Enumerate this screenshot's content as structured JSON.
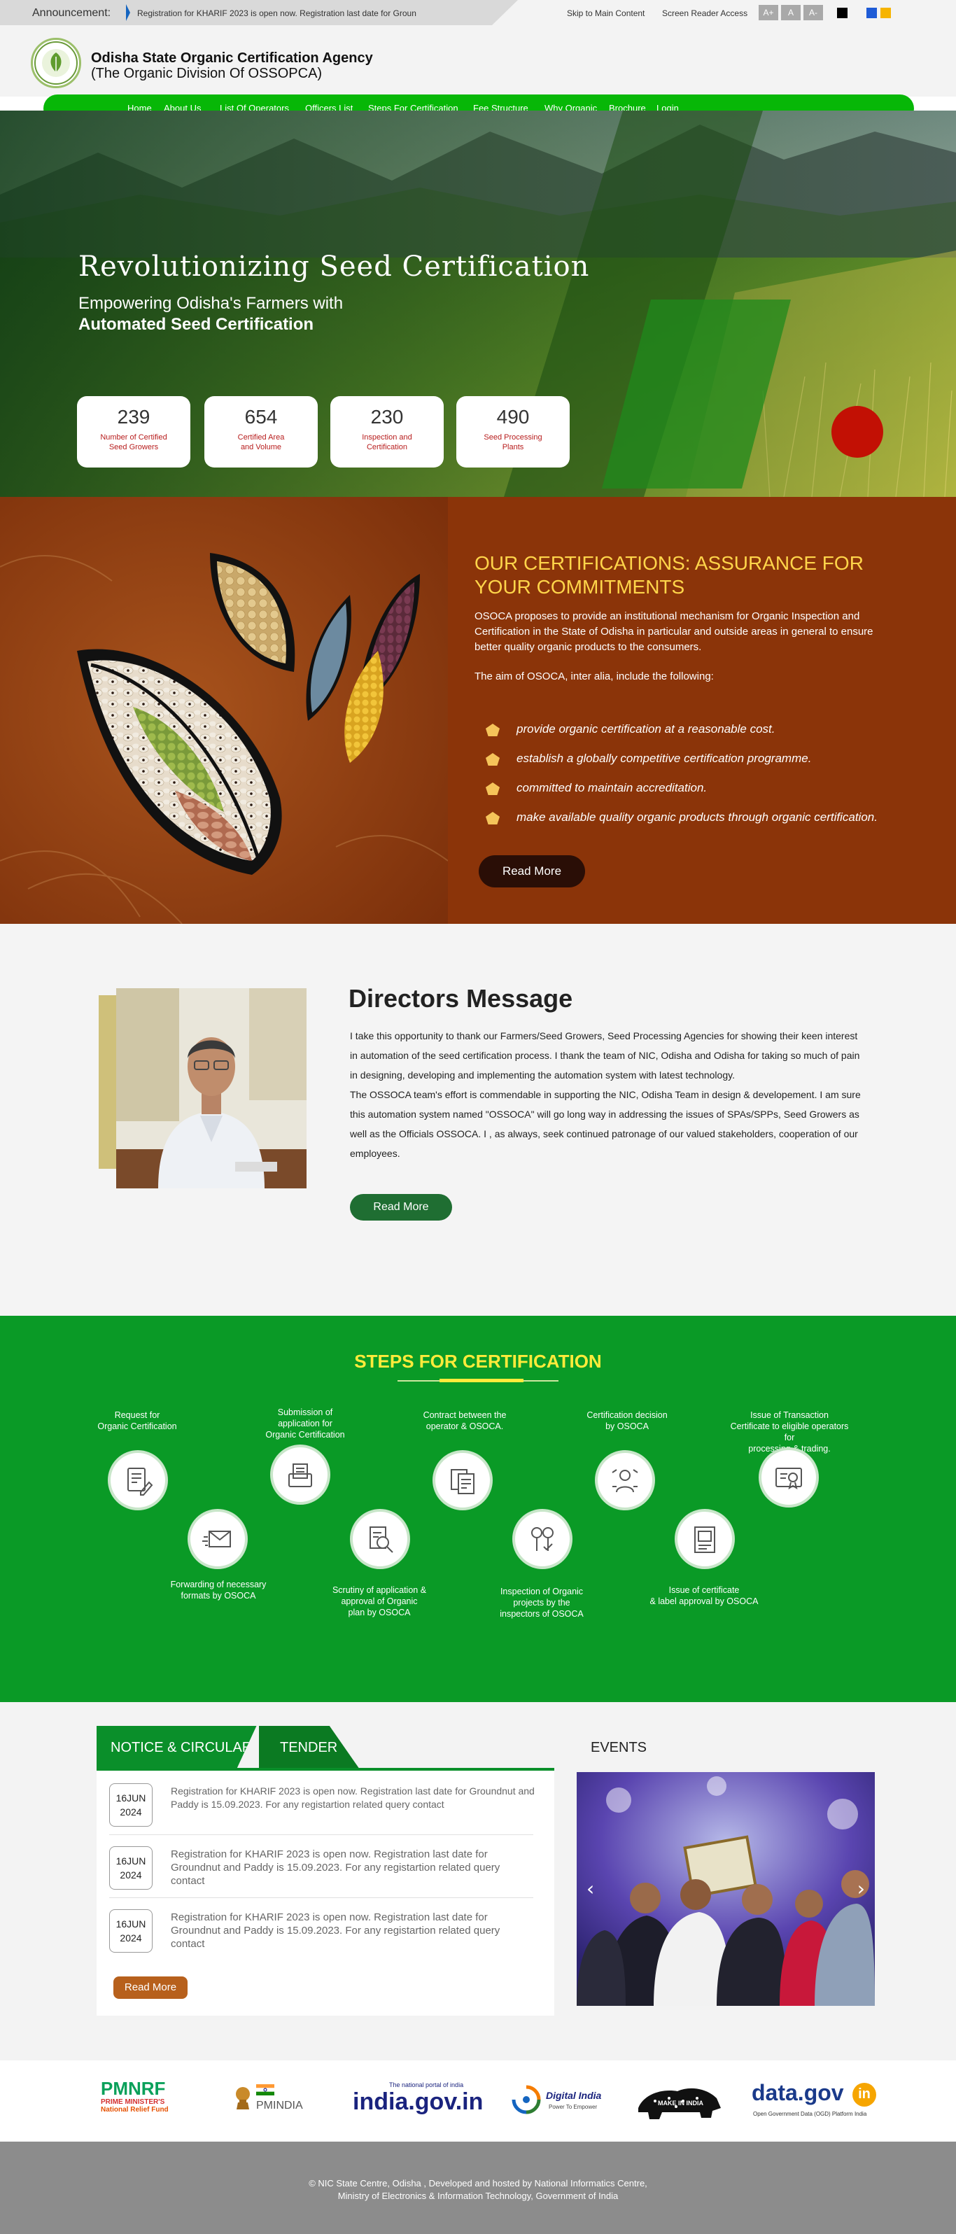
{
  "topbar": {
    "announcement_label": "Announcement:",
    "announcement_text": "Registration for KHARIF 2023 is open now. Registration last date for Groun",
    "skip_link": "Skip to Main Content",
    "screen_reader": "Screen Reader Access",
    "font_increase": "A+",
    "font_normal": "A",
    "font_decrease": "A-",
    "theme_colors": [
      "#000000",
      "#1e5bd6",
      "#f6b400"
    ]
  },
  "header": {
    "title": "Odisha State Organic Certification Agency",
    "subtitle": "(The Organic Division Of OSSOPCA)"
  },
  "nav": [
    "Home",
    "About Us",
    "List Of Operators",
    "Officers List",
    "Steps For Certification",
    "Fee Structure",
    "Why Organic",
    "Brochure",
    "Login"
  ],
  "hero": {
    "title": "Revolutionizing Seed Certification",
    "subtitle_line1": "Empowering Odisha's Farmers with",
    "subtitle_line2": "Automated Seed Certification",
    "stats": [
      {
        "value": "239",
        "label_line1": "Number of Certified",
        "label_line2": "Seed Growers"
      },
      {
        "value": "654",
        "label_line1": "Certified Area",
        "label_line2": "and Volume"
      },
      {
        "value": "230",
        "label_line1": "Inspection and",
        "label_line2": "Certification"
      },
      {
        "value": "490",
        "label_line1": "Seed Processing",
        "label_line2": "Plants"
      }
    ]
  },
  "certifications": {
    "title_line1": "OUR CERTIFICATIONS: ASSURANCE FOR",
    "title_line2": "YOUR COMMITMENTS",
    "paragraph": "OSOCA proposes to provide an institutional mechanism for Organic Inspection and Certification in the State of Odisha in particular and outside areas in general to ensure better quality organic products to the consumers.",
    "aim": "The aim of OSOCA, inter alia, include the following:",
    "items": [
      "provide organic certification at a reasonable cost.",
      "establish a globally competitive certification programme.",
      "committed to maintain accreditation.",
      "make available quality organic products through organic certification."
    ],
    "button": "Read More"
  },
  "directors": {
    "title": "Directors Message",
    "para1": "I take this opportunity to thank our Farmers/Seed Growers, Seed Processing Agencies for showing their keen interest in automation of the seed certification process. I thank the team of NIC, Odisha and Odisha for taking so much of pain in designing, developing and implementing the automation system with latest technology.",
    "para2": "The OSSOCA team's effort is commendable in supporting the NIC, Odisha Team in design & developement. I am sure this automation system named \"OSSOCA\" will go long way in addressing the issues of SPAs/SPPs, Seed Growers as well as the Officials OSSOCA. I , as always, seek continued patronage of our valued stakeholders, cooperation of our employees.",
    "button": "Read More"
  },
  "steps": {
    "title": "STEPS FOR CERTIFICATION",
    "items": [
      {
        "text": "Request for\nOrganic Certification",
        "icon": "form-icon"
      },
      {
        "text": "Forwarding of necessary\nformats by OSOCA",
        "icon": "envelope-icon"
      },
      {
        "text": "Submission of\napplication for\nOrganic Certification",
        "icon": "application-icon"
      },
      {
        "text": "Scrutiny of application &\napproval of Organic\nplan by OSOCA",
        "icon": "scrutiny-icon"
      },
      {
        "text": "Contract between the\noperator & OSOCA.",
        "icon": "contract-icon"
      },
      {
        "text": "Inspection of Organic\nprojects by the\ninspectors of OSOCA",
        "icon": "inspection-icon"
      },
      {
        "text": "Certification decision\nby OSOCA",
        "icon": "decision-icon"
      },
      {
        "text": "Issue of certificate\n& label approval by OSOCA",
        "icon": "certificate-label-icon"
      },
      {
        "text": "Issue of Transaction\nCertificate to eligible operators for\nprocessing & trading.",
        "icon": "transaction-certificate-icon"
      }
    ]
  },
  "notices": {
    "tab_notice": "NOTICE & CIRCULARS",
    "tab_tender": "TENDER",
    "items": [
      {
        "day": "16JUN",
        "year": "2024",
        "text": "Registration for KHARIF 2023 is open now. Registration last date for Groundnut and Paddy is 15.09.2023. For any registartion related query contact"
      },
      {
        "day": "16JUN",
        "year": "2024",
        "text": "Registration for KHARIF 2023 is open now. Registration last date for Groundnut and Paddy is 15.09.2023. For any registartion related query contact"
      },
      {
        "day": "16JUN",
        "year": "2024",
        "text": "Registration for KHARIF 2023 is open now. Registration last date for Groundnut and Paddy is 15.09.2023. For any registartion related query contact"
      }
    ],
    "button": "Read More"
  },
  "events": {
    "title": "EVENTS",
    "prev": "‹",
    "next": "›"
  },
  "partners": {
    "pmnrf_title": "PMNRF",
    "pmnrf_line1": "PRIME MINISTER'S",
    "pmnrf_line2": "National Relief Fund",
    "pmindia": "PMINDIA",
    "india_gov_tag": "The national portal of india",
    "india_gov": "india.gov.in",
    "digital_india": "Digital India",
    "digital_india_tag": "Power To Empower",
    "make_in_india": "MAKE IN INDIA",
    "data_gov": "data.gov",
    "data_gov_suffix": "in",
    "data_gov_tag": "Open Government Data (OGD) Platform India"
  },
  "footer": {
    "line1": "© NIC State Centre, Odisha , Developed and hosted by National Informatics Centre,",
    "line2": "Ministry of Electronics & Information Technology, Government of India"
  }
}
